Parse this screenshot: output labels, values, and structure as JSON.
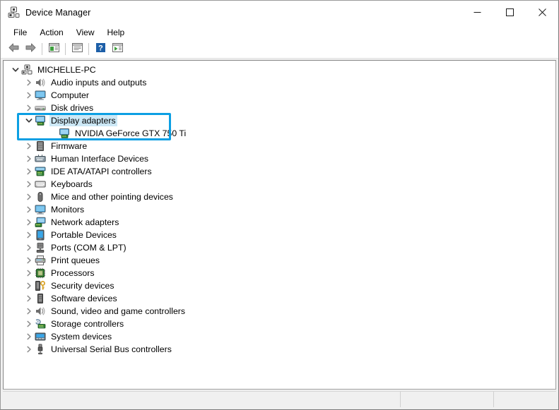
{
  "window": {
    "title": "Device Manager",
    "title_icon": "device-manager-icon",
    "minimize_label": "Minimize",
    "maximize_label": "Maximize",
    "close_label": "Close"
  },
  "menubar": {
    "items": [
      {
        "label": "File"
      },
      {
        "label": "Action"
      },
      {
        "label": "View"
      },
      {
        "label": "Help"
      }
    ]
  },
  "toolbar": {
    "buttons": [
      {
        "name": "back-button",
        "icon": "back-arrow-icon",
        "label": "Back"
      },
      {
        "name": "forward-button",
        "icon": "forward-arrow-icon",
        "label": "Forward"
      },
      {
        "name": "show-hide-console-tree-button",
        "icon": "console-tree-icon",
        "label": "Show/Hide Console Tree"
      },
      {
        "name": "properties-button",
        "icon": "properties-icon",
        "label": "Properties"
      },
      {
        "name": "help-button",
        "icon": "help-question-icon",
        "label": "Help"
      },
      {
        "name": "scan-hardware-changes-button",
        "icon": "scan-hardware-icon",
        "label": "Scan for hardware changes"
      }
    ]
  },
  "tree": {
    "root": {
      "label": "MICHELLE-PC",
      "icon": "computer-root-icon",
      "expanded": true
    },
    "nodes": [
      {
        "label": "Audio inputs and outputs",
        "icon": "speaker-icon",
        "expanded": false,
        "selected": false
      },
      {
        "label": "Computer",
        "icon": "monitor-icon",
        "expanded": false,
        "selected": false
      },
      {
        "label": "Disk drives",
        "icon": "disk-drive-icon",
        "expanded": false,
        "selected": false
      },
      {
        "label": "Display adapters",
        "icon": "display-adapter-icon",
        "expanded": true,
        "selected": true,
        "children": [
          {
            "label": "NVIDIA GeForce GTX 750 Ti",
            "icon": "display-adapter-icon"
          }
        ]
      },
      {
        "label": "Firmware",
        "icon": "firmware-icon",
        "expanded": false,
        "selected": false
      },
      {
        "label": "Human Interface Devices",
        "icon": "hid-icon",
        "expanded": false,
        "selected": false
      },
      {
        "label": "IDE ATA/ATAPI controllers",
        "icon": "ide-controller-icon",
        "expanded": false,
        "selected": false
      },
      {
        "label": "Keyboards",
        "icon": "keyboard-icon",
        "expanded": false,
        "selected": false
      },
      {
        "label": "Mice and other pointing devices",
        "icon": "mouse-icon",
        "expanded": false,
        "selected": false
      },
      {
        "label": "Monitors",
        "icon": "monitor-icon",
        "expanded": false,
        "selected": false
      },
      {
        "label": "Network adapters",
        "icon": "network-adapter-icon",
        "expanded": false,
        "selected": false
      },
      {
        "label": "Portable Devices",
        "icon": "portable-device-icon",
        "expanded": false,
        "selected": false
      },
      {
        "label": "Ports (COM & LPT)",
        "icon": "port-icon",
        "expanded": false,
        "selected": false
      },
      {
        "label": "Print queues",
        "icon": "printer-icon",
        "expanded": false,
        "selected": false
      },
      {
        "label": "Processors",
        "icon": "processor-icon",
        "expanded": false,
        "selected": false
      },
      {
        "label": "Security devices",
        "icon": "security-device-icon",
        "expanded": false,
        "selected": false
      },
      {
        "label": "Software devices",
        "icon": "software-device-icon",
        "expanded": false,
        "selected": false
      },
      {
        "label": "Sound, video and game controllers",
        "icon": "speaker-icon",
        "expanded": false,
        "selected": false
      },
      {
        "label": "Storage controllers",
        "icon": "storage-controller-icon",
        "expanded": false,
        "selected": false
      },
      {
        "label": "System devices",
        "icon": "system-device-icon",
        "expanded": false,
        "selected": false
      },
      {
        "label": "Universal Serial Bus controllers",
        "icon": "usb-controller-icon",
        "expanded": false,
        "selected": false
      }
    ]
  },
  "annotation": {
    "color": "#0c9fe3",
    "target": "Display adapters"
  },
  "statusbar": {
    "main_text": "",
    "cell_a_text": "",
    "cell_b_text": ""
  }
}
